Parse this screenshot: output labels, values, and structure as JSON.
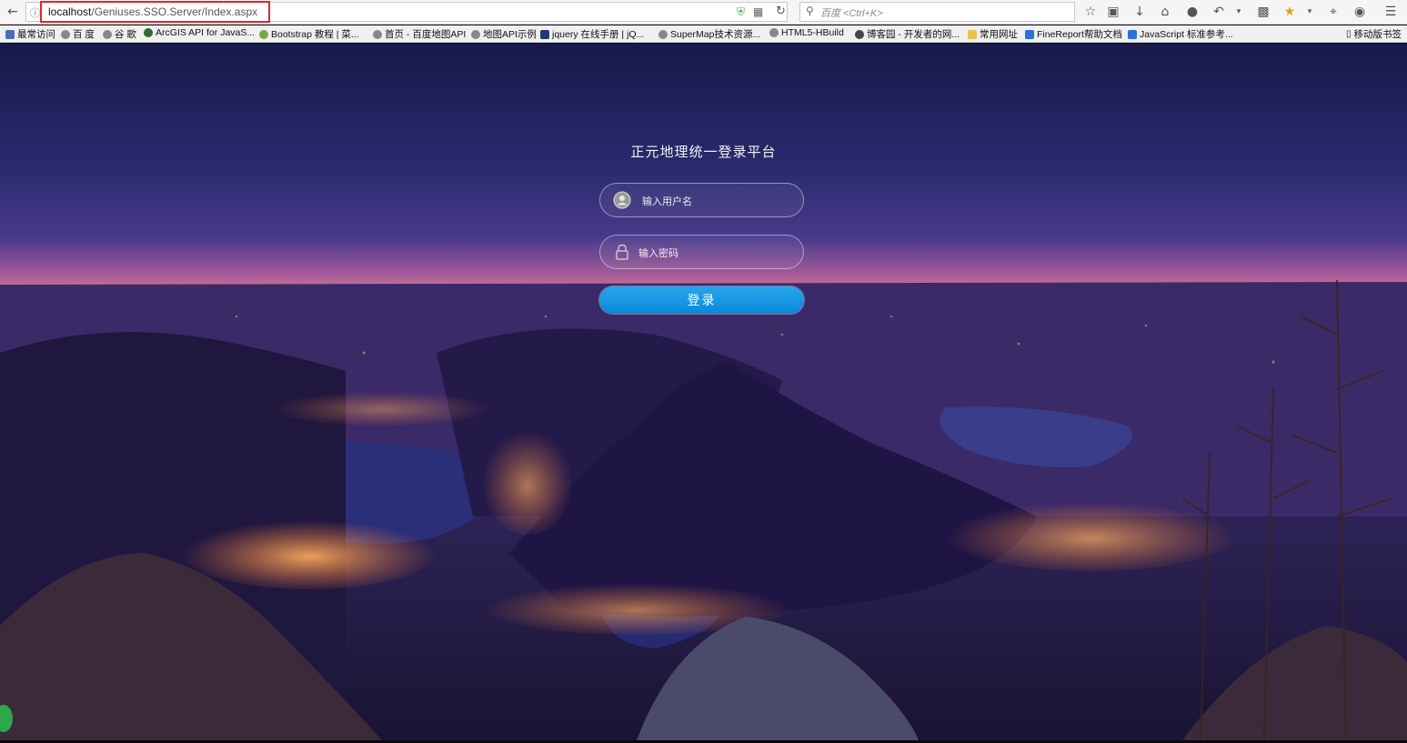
{
  "browser": {
    "url_host": "localhost",
    "url_path": "/Geniuses.SSO.Server/Index.aspx",
    "search_placeholder": "百度 <Ctrl+K>"
  },
  "bookmarks": [
    "最常访问",
    "百 度",
    "谷 歌",
    "ArcGIS API for JavaS...",
    "Bootstrap 教程 | 菜...",
    "首页 - 百度地图API",
    "地图API示例",
    "jquery 在线手册 | jQ...",
    "SuperMap技术资源...",
    "HTML5-HBuild",
    "博客园 - 开发者的网...",
    "常用网址",
    "FineReport帮助文档",
    "JavaScript 标准参考..."
  ],
  "mobile_bookmarks": "移动版书签",
  "login": {
    "title": "正元地理统一登录平台",
    "username_placeholder": "输入用户名",
    "password_placeholder": "输入密码",
    "submit_label": "登录"
  },
  "icons": {
    "back": "back-arrow-icon",
    "info": "info-icon",
    "shield": "shield-icon",
    "qr": "qr-code-icon",
    "reload": "reload-icon",
    "search": "search-icon",
    "star": "star-icon",
    "download": "download-icon",
    "home": "home-icon",
    "menu": "menu-icon",
    "user": "user-icon",
    "lock": "lock-icon"
  },
  "colors": {
    "login_button": "#1a97e6",
    "url_highlight": "#e0262a"
  }
}
